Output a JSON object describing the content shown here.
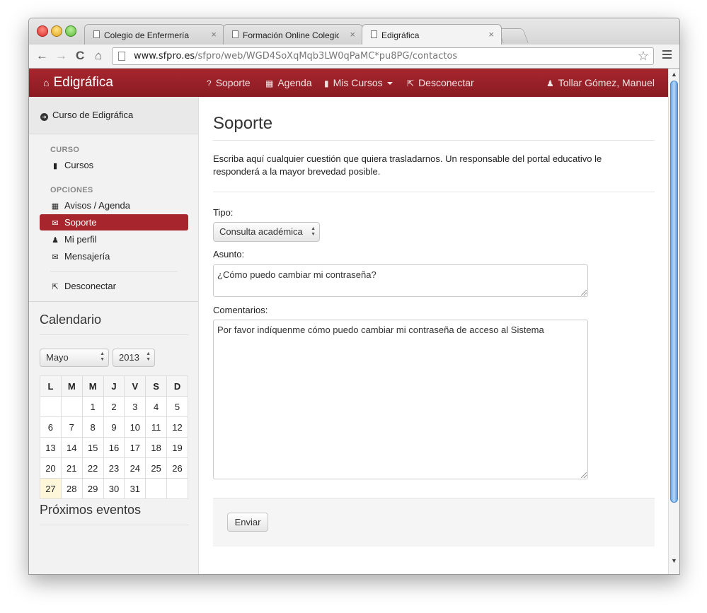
{
  "browser": {
    "tabs": [
      {
        "label": "Colegio de Enfermería",
        "active": false
      },
      {
        "label": "Formación Online Colegio",
        "active": false
      },
      {
        "label": "Edigráfica",
        "active": true
      }
    ],
    "tab_close": "×",
    "nav": {
      "back": "←",
      "forward": "→",
      "reload": "C",
      "home": "⌂"
    },
    "url_host": "www.sfpro.es",
    "url_path": "/sfpro/web/WGD4SoXqMqb3LW0qPaMC*pu8PG/contactos",
    "star": "☆"
  },
  "navbar": {
    "brand": "Edigráfica",
    "items": [
      {
        "label": "Soporte",
        "icon": "?"
      },
      {
        "label": "Agenda",
        "icon": "▦"
      },
      {
        "label": "Mis Cursos",
        "icon": "▮"
      },
      {
        "label": "Desconectar",
        "icon": "⇱"
      }
    ],
    "user": "Tollar Gómez, Manuel"
  },
  "sidebar": {
    "course_link": "Curso de Edigráfica",
    "curso_header": "CURSO",
    "cursos": "Cursos",
    "opciones_header": "OPCIONES",
    "avisos": "Avisos / Agenda",
    "soporte": "Soporte",
    "perfil": "Mi perfil",
    "mensajeria": "Mensajería",
    "desconectar": "Desconectar",
    "calendar_title": "Calendario",
    "month": "Mayo",
    "year": "2013",
    "weekdays": [
      "L",
      "M",
      "M",
      "J",
      "V",
      "S",
      "D"
    ],
    "weeks": [
      [
        "",
        "",
        "1",
        "2",
        "3",
        "4",
        "5"
      ],
      [
        "6",
        "7",
        "8",
        "9",
        "10",
        "11",
        "12"
      ],
      [
        "13",
        "14",
        "15",
        "16",
        "17",
        "18",
        "19"
      ],
      [
        "20",
        "21",
        "22",
        "23",
        "24",
        "25",
        "26"
      ],
      [
        "27",
        "28",
        "29",
        "30",
        "31",
        "",
        ""
      ]
    ],
    "today": "27",
    "events_title": "Próximos eventos"
  },
  "main": {
    "title": "Soporte",
    "intro": "Escriba aquí cualquier cuestión que quiera trasladarnos. Un responsable del portal educativo le responderá a la mayor brevedad posible.",
    "tipo_label": "Tipo:",
    "tipo_value": "Consulta académica",
    "asunto_label": "Asunto:",
    "asunto_value": "¿Cómo puedo cambiar mi contraseña?",
    "comentarios_label": "Comentarios:",
    "comentarios_value": "Por favor indíquenme cómo puedo cambiar mi contraseña de acceso al Sistema",
    "submit": "Enviar"
  },
  "colors": {
    "brand": "#a7262e",
    "active_item": "#a7262e",
    "today": "#fdf6d8"
  }
}
